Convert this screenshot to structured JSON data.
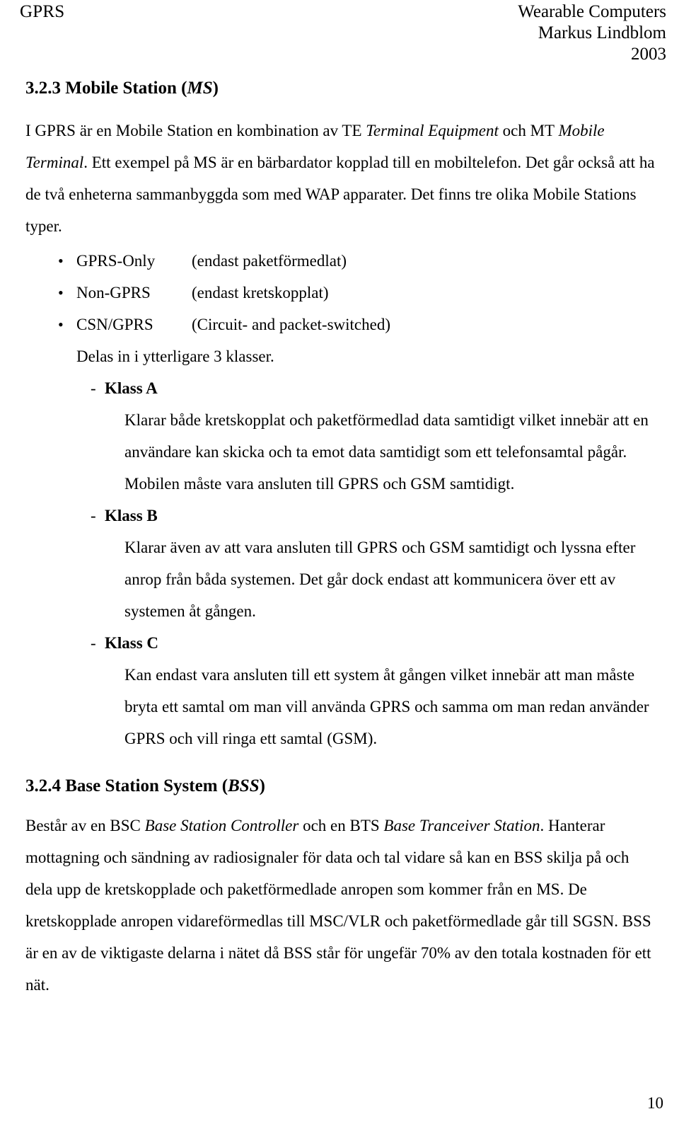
{
  "header": {
    "left": "GPRS",
    "right_line1": "Wearable Computers",
    "right_line2": "Markus Lindblom",
    "right_line3": "2003"
  },
  "section_ms": {
    "number": "3.2.3 Mobile Station (",
    "italic": "MS",
    "close": ")",
    "intro_1": "I GPRS är en Mobile Station en kombination av TE ",
    "intro_1_ital": "Terminal Equipment",
    "intro_1_b": " och MT ",
    "intro_2_ital": "Mobile Terminal",
    "intro_2": ". Ett exempel på MS är en bärbardator kopplad till en mobiltelefon. Det går också att ha de två enheterna sammanbyggda som med WAP apparater. Det finns tre olika Mobile Stations typer.",
    "bullets": [
      {
        "term": "GPRS-Only",
        "desc": "(endast paketförmedlat)"
      },
      {
        "term": "Non-GPRS",
        "desc": "(endast kretskopplat)"
      },
      {
        "term": "CSN/GPRS",
        "desc": "(Circuit- and packet-switched)"
      }
    ],
    "subline": "Delas in i ytterligare 3 klasser.",
    "classes": [
      {
        "label": "Klass A",
        "body": "Klarar både kretskopplat och paketförmedlad data samtidigt vilket innebär att en användare kan skicka och ta emot data samtidigt som ett telefonsamtal pågår. Mobilen måste vara ansluten till GPRS och GSM samtidigt."
      },
      {
        "label": "Klass B",
        "body": "Klarar även av att vara ansluten till GPRS och GSM samtidigt och lyssna efter anrop från båda systemen. Det går dock endast att kommunicera över ett av systemen åt gången."
      },
      {
        "label": "Klass C",
        "body": "Kan endast vara ansluten till ett system åt gången vilket innebär att man måste bryta ett samtal om man vill använda GPRS och samma om man redan använder GPRS och vill ringa ett samtal (GSM)."
      }
    ]
  },
  "section_bss": {
    "number": "3.2.4 Base Station System (",
    "italic": "BSS",
    "close": ")",
    "para_a": "Består av en BSC ",
    "para_a_ital": "Base Station Controller",
    "para_b": " och en BTS ",
    "para_b_ital": "Base Tranceiver Station",
    "para_c": ".",
    "para_rest": "Hanterar mottagning och sändning av radiosignaler för data och tal vidare så kan en BSS skilja på och dela upp de kretskopplade och paketförmedlade anropen som kommer från en MS. De kretskopplade anropen vidareförmedlas till MSC/VLR och paketförmedlade går till SGSN. BSS är en av de viktigaste delarna i nätet då BSS står för ungefär 70% av den totala kostnaden för ett nät."
  },
  "footer": {
    "page_number": "10"
  }
}
